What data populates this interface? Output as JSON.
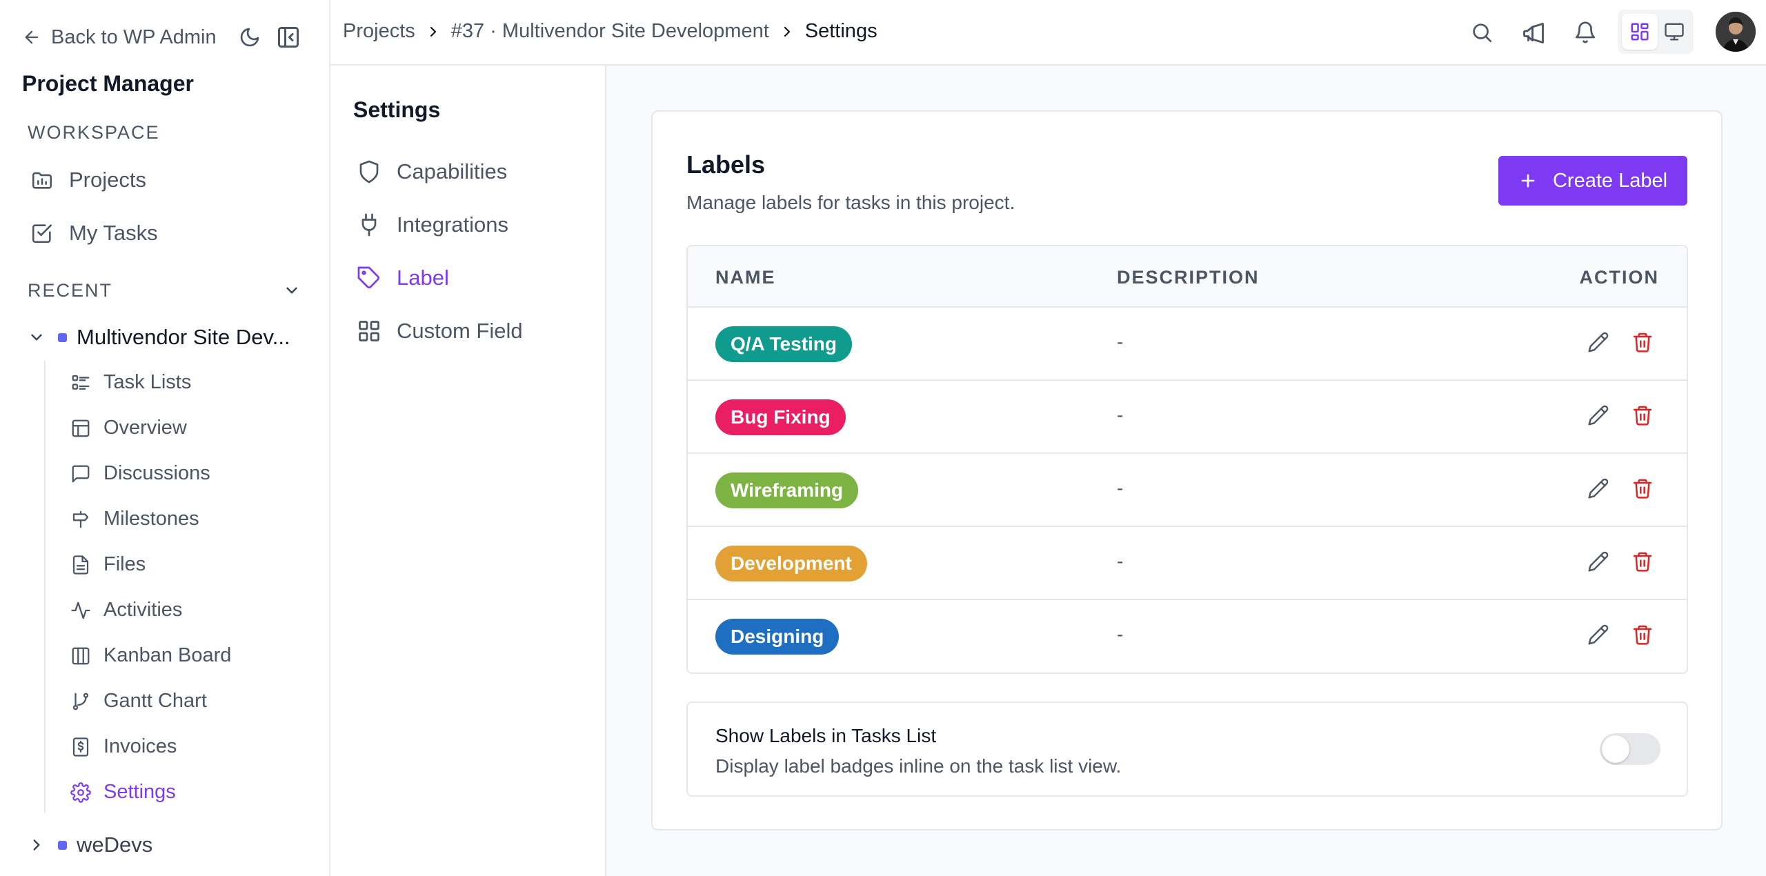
{
  "sidebar": {
    "back_label": "Back to WP Admin",
    "app_title": "Project Manager",
    "workspace_label": "WORKSPACE",
    "workspace_items": [
      {
        "label": "Projects",
        "icon": "projects-icon"
      },
      {
        "label": "My Tasks",
        "icon": "tasks-icon"
      }
    ],
    "recent_label": "RECENT",
    "recent_project": "Multivendor Site Dev...",
    "project_items": [
      {
        "label": "Task Lists",
        "icon": "task-list-icon"
      },
      {
        "label": "Overview",
        "icon": "overview-icon"
      },
      {
        "label": "Discussions",
        "icon": "chat-icon"
      },
      {
        "label": "Milestones",
        "icon": "signpost-icon"
      },
      {
        "label": "Files",
        "icon": "file-icon"
      },
      {
        "label": "Activities",
        "icon": "activity-icon"
      },
      {
        "label": "Kanban Board",
        "icon": "kanban-icon"
      },
      {
        "label": "Gantt Chart",
        "icon": "gantt-icon"
      },
      {
        "label": "Invoices",
        "icon": "invoice-icon"
      },
      {
        "label": "Settings",
        "icon": "gear-icon"
      }
    ],
    "other_project": "weDevs"
  },
  "breadcrumb": {
    "items": [
      "Projects",
      "#37 · Multivendor Site Development",
      "Settings"
    ]
  },
  "settings_nav": {
    "title": "Settings",
    "items": [
      {
        "label": "Capabilities",
        "icon": "shield-icon"
      },
      {
        "label": "Integrations",
        "icon": "plug-icon"
      },
      {
        "label": "Label",
        "icon": "tag-icon"
      },
      {
        "label": "Custom Field",
        "icon": "grid-icon"
      }
    ]
  },
  "labels_card": {
    "title": "Labels",
    "subtitle": "Manage labels for tasks in this project.",
    "create_button": "Create Label",
    "columns": [
      "NAME",
      "DESCRIPTION",
      "ACTION"
    ],
    "rows": [
      {
        "name": "Q/A Testing",
        "color": "#0f9b8e",
        "description": "-"
      },
      {
        "name": "Bug Fixing",
        "color": "#e91e63",
        "description": "-"
      },
      {
        "name": "Wireframing",
        "color": "#7cb342",
        "description": "-"
      },
      {
        "name": "Development",
        "color": "#e3a034",
        "description": "-"
      },
      {
        "name": "Designing",
        "color": "#1e6fc2",
        "description": "-"
      }
    ],
    "toggle_title": "Show Labels in Tasks List",
    "toggle_description": "Display label badges inline on the task list view.",
    "toggle_on": false
  },
  "colors": {
    "accent": "#7e3af2",
    "danger": "#dc2626",
    "project_dot": "#6366f1"
  }
}
